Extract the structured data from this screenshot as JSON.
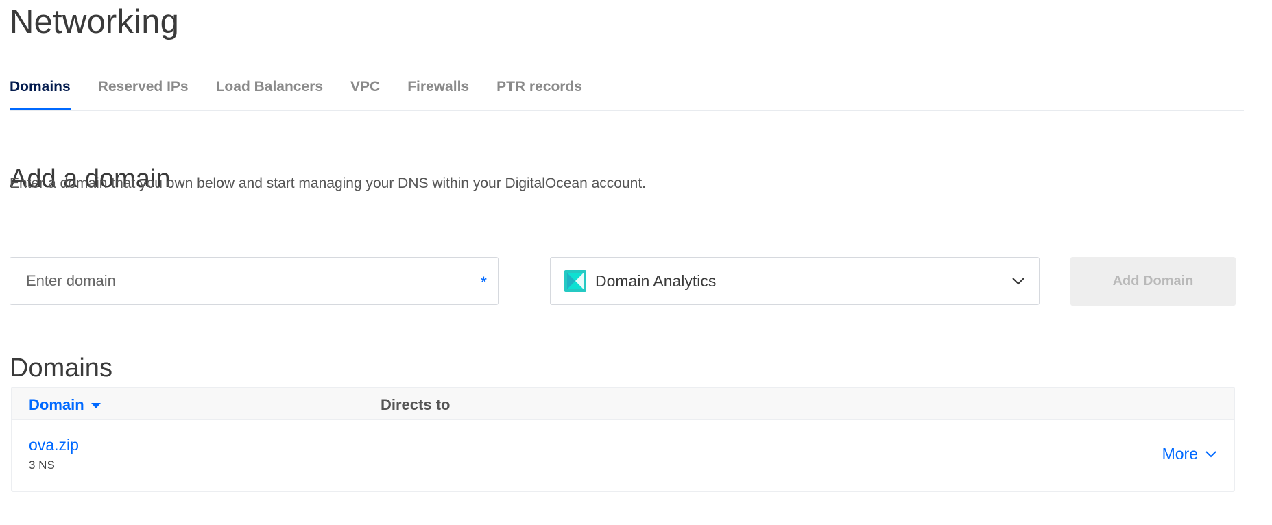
{
  "page_title": "Networking",
  "tabs": [
    {
      "label": "Domains",
      "active": true
    },
    {
      "label": "Reserved IPs",
      "active": false
    },
    {
      "label": "Load Balancers",
      "active": false
    },
    {
      "label": "VPC",
      "active": false
    },
    {
      "label": "Firewalls",
      "active": false
    },
    {
      "label": "PTR records",
      "active": false
    }
  ],
  "add_domain": {
    "title": "Add a domain",
    "description": "Enter a domain that you own below and start managing your DNS within your DigitalOcean account.",
    "input_placeholder": "Enter domain",
    "input_value": "",
    "required_mark": "*",
    "project_select": {
      "selected": "Domain Analytics",
      "icon": "project-icon",
      "icon_colors": [
        "#0fe0d2",
        "#25b8c8"
      ]
    },
    "submit_label": "Add Domain",
    "submit_disabled": true
  },
  "domains": {
    "title": "Domains",
    "columns": {
      "domain": "Domain",
      "directs_to": "Directs to"
    },
    "rows": [
      {
        "name": "ova.zip",
        "ns": "3 NS",
        "directs_to": "",
        "more_label": "More"
      }
    ]
  },
  "colors": {
    "accent": "#0069ff",
    "nav_active": "#031b4e",
    "disabled_bg": "#eeeeee"
  }
}
